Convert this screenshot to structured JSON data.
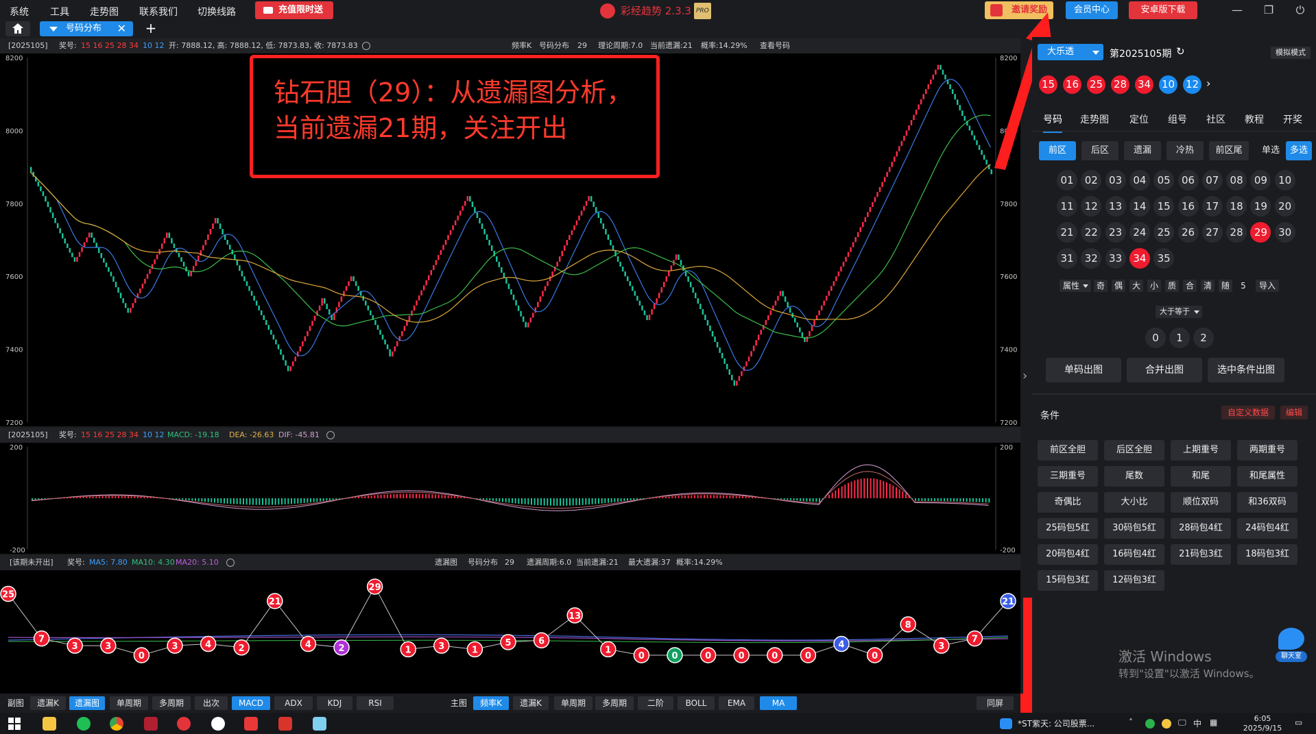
{
  "menu": [
    "系统",
    "工具",
    "走势图",
    "联系我们",
    "切换线路"
  ],
  "promo_label": "充值限时送",
  "app_title": "彩经趋势 2.3.3",
  "app_badge": "PRO",
  "invite_label": "邀请奖励",
  "member_label": "会员中心",
  "android_label": "安卓版下载",
  "active_tab": "号码分布",
  "add_tab_icon": "+",
  "top_panel": {
    "period": "[2025105]",
    "award_label": "奖号:",
    "front_numbers": "15 16 25 28 34",
    "back_numbers": "10 12",
    "ohlc": "开: 7888.12, 高: 7888.12, 低: 7873.83, 收: 7873.83",
    "freq_label": "频率K",
    "dist_label": "号码分布",
    "dist_value": "29",
    "theory": "理论周期:7.0",
    "current_miss": "当前遗漏:21",
    "prob": "概率:14.29%",
    "view_label": "查看号码"
  },
  "annotation": {
    "line1": "钻石胆（29）：从遗漏图分析，",
    "line2": "当前遗漏21期，关注开出"
  },
  "macd_panel": {
    "period": "[2025105]",
    "award_label": "奖号:",
    "front_numbers": "15 16 25 28 34",
    "back_numbers": "10 12",
    "macd": "MACD: -19.18",
    "dea": "DEA: -26.63",
    "dif": "DIF: -45.81"
  },
  "miss_panel": {
    "period": "[该期未开出]",
    "award_label": "奖号:",
    "ma5": "MA5: 7.80",
    "ma10": "MA10: 4.30",
    "ma20": "MA20: 5.10",
    "chart_label": "遗漏图",
    "dist_label": "号码分布",
    "dist_value": "29",
    "miss_period": "遗漏周期:6.0",
    "current_miss": "当前遗漏:21",
    "max_miss": "最大遗漏:37",
    "prob": "概率:14.29%"
  },
  "bottom_left": {
    "label": "副图",
    "buttons": [
      "遗漏K",
      "遗漏图",
      "单周期",
      "多周期",
      "出次",
      "MACD",
      "ADX",
      "KDJ",
      "RSI"
    ]
  },
  "bottom_main": {
    "label": "主图",
    "buttons": [
      "频率K",
      "遗漏K",
      "单周期",
      "多周期",
      "二阶",
      "BOLL",
      "EMA",
      "MA"
    ]
  },
  "same_screen": "同屏",
  "right_panel": {
    "lottery": "大乐透",
    "issue": "第2025105期",
    "sim_mode": "模拟模式",
    "front_balls": [
      "15",
      "16",
      "25",
      "28",
      "34"
    ],
    "back_balls": [
      "10",
      "12"
    ],
    "tabs": [
      "号码",
      "走势图",
      "定位",
      "组号",
      "社区",
      "教程",
      "开奖"
    ],
    "zones": [
      "前区",
      "后区",
      "遗漏",
      "冷热",
      "前区尾"
    ],
    "single_label": "单选",
    "multi_label": "多选",
    "numbers": [
      "01",
      "02",
      "03",
      "04",
      "05",
      "06",
      "07",
      "08",
      "09",
      "10",
      "11",
      "12",
      "13",
      "14",
      "15",
      "16",
      "17",
      "18",
      "19",
      "20",
      "21",
      "22",
      "23",
      "24",
      "25",
      "26",
      "27",
      "28",
      "29",
      "30",
      "31",
      "32",
      "33",
      "34",
      "35"
    ],
    "selected_numbers": [
      "29",
      "34"
    ],
    "attr_select": "属性",
    "attrs": [
      "奇",
      "偶",
      "大",
      "小",
      "质",
      "合",
      "清",
      "随"
    ],
    "attr_count": "5",
    "import_label": "导入",
    "compare_label": "大于等于",
    "compare_values": [
      "0",
      "1",
      "2"
    ],
    "op_buttons": [
      "单码出图",
      "合并出图",
      "选中条件出图"
    ],
    "cond_title": "条件",
    "custom_data": "自定义数据",
    "edit_label": "编辑",
    "conditions": [
      "前区全胆",
      "后区全胆",
      "上期重号",
      "两期重号",
      "三期重号",
      "尾数",
      "和尾",
      "和尾属性",
      "奇偶比",
      "大小比",
      "顺位双码",
      "和36双码",
      "25码包5红",
      "30码包5红",
      "28码包4红",
      "24码包4红",
      "20码包4红",
      "16码包4红",
      "21码包3红",
      "18码包3红",
      "15码包3红",
      "12码包3红"
    ],
    "watermark_title": "激活 Windows",
    "watermark_sub": "转到\"设置\"以激活 Windows。",
    "chat_label": "聊天室"
  },
  "taskbar": {
    "news": "*ST紫天: 公司股票...",
    "ime": "中",
    "time": "6:05",
    "date": "2025/9/15"
  },
  "chart_data": [
    {
      "type": "line",
      "name": "频率K",
      "y_ticks": [
        8200,
        8000,
        7800,
        7600,
        7400,
        7200
      ],
      "ylim": [
        7200,
        8200
      ],
      "x": [
        "2025105"
      ],
      "series_close_shape": [
        7900,
        7820,
        7760,
        7690,
        7640,
        7720,
        7650,
        7600,
        7540,
        7500,
        7620,
        7660,
        7720,
        7690,
        7640,
        7600,
        7700,
        7760,
        7700,
        7660,
        7600,
        7560,
        7480,
        7400,
        7340,
        7380,
        7450,
        7520,
        7540,
        7480,
        7500,
        7560,
        7600,
        7560,
        7520,
        7480,
        7440,
        7400,
        7380,
        7520,
        7700,
        7780,
        7820,
        7760,
        7700,
        7640,
        7580,
        7520,
        7460,
        7500,
        7560,
        7640,
        7700,
        7780,
        7820,
        7760,
        7700,
        7640,
        7560,
        7480,
        7540,
        7600,
        7660,
        7600,
        7540,
        7480,
        7420,
        7360,
        7300,
        7380,
        7440,
        7520,
        7560,
        7500,
        7460,
        7420,
        7480,
        7560,
        7680,
        7900,
        8100,
        8180,
        8140,
        8100,
        8040,
        7960,
        7880
      ],
      "ma_series": [
        "blue",
        "green",
        "yellow"
      ]
    },
    {
      "type": "bar",
      "name": "MACD",
      "y_ticks": [
        200,
        -200
      ],
      "ylim": [
        -200,
        200
      ],
      "values": {
        "macd": -19.18,
        "dea": -26.63,
        "dif": -45.81
      }
    },
    {
      "type": "line",
      "name": "遗漏图",
      "values": [
        25,
        7,
        3,
        3,
        0,
        3,
        4,
        2,
        21,
        4,
        2,
        29,
        1,
        3,
        1,
        5,
        6,
        13,
        1,
        0,
        0,
        0,
        0,
        0,
        0,
        4,
        0,
        8,
        3,
        7,
        21
      ],
      "ma5": 7.8,
      "ma10": 4.3,
      "ma20": 5.1
    }
  ]
}
